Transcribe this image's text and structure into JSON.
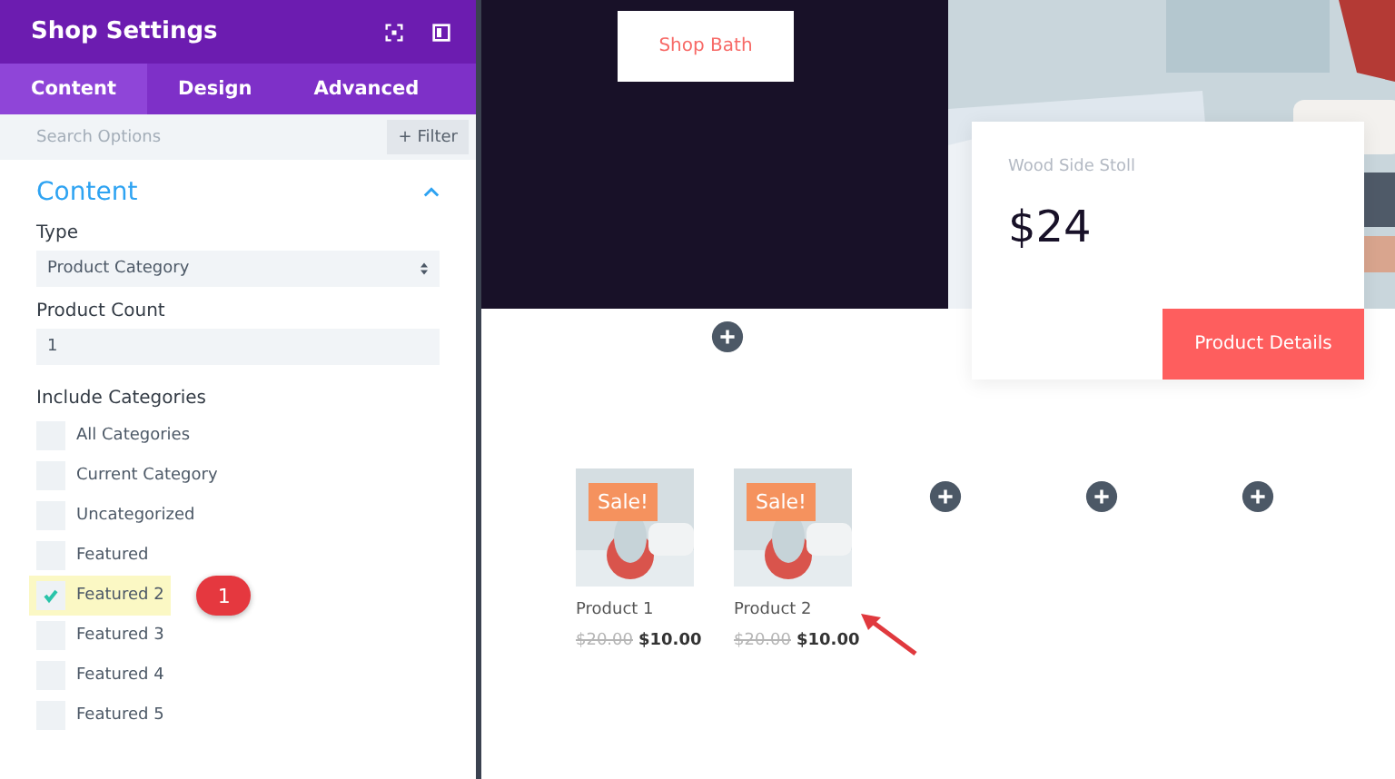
{
  "panel": {
    "title": "Shop Settings",
    "tabs": [
      {
        "label": "Content",
        "selected": true
      },
      {
        "label": "Design",
        "selected": false
      },
      {
        "label": "Advanced",
        "selected": false
      }
    ],
    "search": {
      "placeholder": "Search Options"
    },
    "filter_button": "+ Filter",
    "section": {
      "title": "Content",
      "expanded": true
    },
    "type": {
      "label": "Type",
      "value": "Product Category"
    },
    "count": {
      "label": "Product Count",
      "value": "1"
    },
    "categories": {
      "label": "Include Categories",
      "items": [
        {
          "label": "All Categories",
          "checked": false
        },
        {
          "label": "Current Category",
          "checked": false
        },
        {
          "label": "Uncategorized",
          "checked": false
        },
        {
          "label": "Featured",
          "checked": false
        },
        {
          "label": "Featured 2",
          "checked": true,
          "callout": "1"
        },
        {
          "label": "Featured 3",
          "checked": false
        },
        {
          "label": "Featured 4",
          "checked": false
        },
        {
          "label": "Featured 5",
          "checked": false
        }
      ]
    }
  },
  "canvas": {
    "hero_button": "Shop Bath",
    "card": {
      "name": "Wood Side Stoll",
      "price": "$24",
      "button": "Product Details"
    },
    "products": [
      {
        "name": "Product 1",
        "badge": "Sale!",
        "old_price": "$20.00",
        "price": "$10.00",
        "pointed": false
      },
      {
        "name": "Product 2",
        "badge": "Sale!",
        "old_price": "$20.00",
        "price": "$10.00",
        "pointed": true
      }
    ]
  }
}
